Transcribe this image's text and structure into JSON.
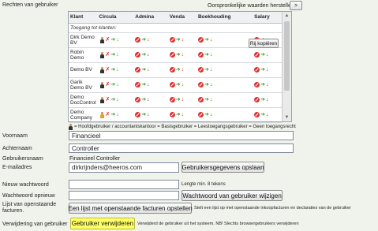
{
  "section_rights_label": "Rechten van gebruiker",
  "restore_text": "Oorspronkelijke waarden herstellen",
  "restore_button": ">",
  "table": {
    "headers": [
      "Klant",
      "Circula",
      "Admina",
      "Venda",
      "Boekhouding",
      "Salary"
    ],
    "subheader": "Toegang tot klanten:",
    "rows": [
      {
        "name": "Dirk Demo BV",
        "cells": [
          "hoofd",
          "no",
          "no",
          "no",
          "no"
        ]
      },
      {
        "name": "Robin Demo",
        "cells": [
          "hoofd",
          "no",
          "no",
          "no",
          "no"
        ]
      },
      {
        "name": "Demo BV",
        "cells": [
          "hoofd",
          "no",
          "no",
          "no",
          "no"
        ]
      },
      {
        "name": "Garik Demo BV",
        "cells": [
          "hoofd",
          "no",
          "no",
          "no",
          "no"
        ]
      },
      {
        "name": "Demo DocControl",
        "cells": [
          "hoofd",
          "no",
          "no",
          "no",
          "no"
        ]
      },
      {
        "name": "Demo Company",
        "cells": [
          "basis",
          "no",
          "no",
          "no",
          "no"
        ]
      }
    ]
  },
  "copy_rights_button": "Rij kopiëren",
  "legend": "= Hoofdgebruiker / accountantskantoor    = Basisgebruiker    = Leestoegangsgebruiker    = Geen toegangsrecht",
  "fields": {
    "voornaam_label": "Voornaam",
    "voornaam_value": "Financieel",
    "achternaam_label": "Achternaam",
    "achternaam_value": "Controller",
    "gebruikersnaam_label": "Gebruikersnaam",
    "gebruikersnaam_value": "Financieel Controller",
    "email_label": "E-mailadres",
    "email_value": "dirkrijnders@heeros.com",
    "save_button": "Gebruikersgegevens opslaan",
    "pw_label": "Nieuw wachtwoord",
    "pw_hint": "Lengte min. 8 tekens",
    "pw2_label": "Wachtwoord opnieuw",
    "pw_button": "Wachtwoord van gebruiker wijzigen",
    "invoices_label": "Lijst van openstaande facturen.",
    "invoices_button": "Een lijst met openstaande facturen opstellen",
    "invoices_desc": "Stelt een lijst op met openstaande inkoopfacturen en declaraties van de gebruiker",
    "delete_label": "Verwijdering van gebruiker",
    "delete_button": "Gebruiker verwijderen",
    "delete_desc": "Verwijderd de gebruiker uit het systeem. NB! Slechts browsergebruikers verwijderen"
  }
}
